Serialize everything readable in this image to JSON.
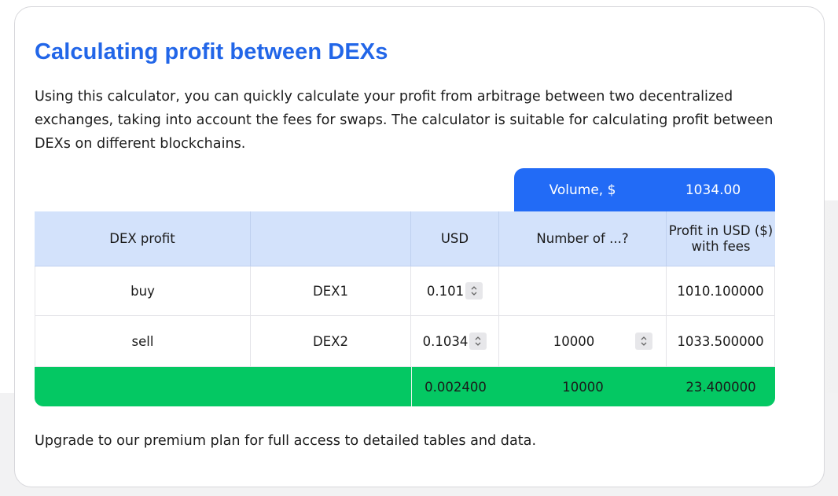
{
  "title": "Calculating profit between DEXs",
  "description": "Using this calculator, you can quickly calculate your profit from arbitrage between two decentralized exchanges, taking into account the fees for swaps. The calculator is suitable for calculating profit between DEXs on different blockchains.",
  "volume": {
    "label": "Volume, $",
    "value": "1034.00"
  },
  "table": {
    "headers": [
      "DEX profit",
      "",
      "USD",
      "Number of ...?",
      "Profit in USD ($) with fees"
    ],
    "rows": [
      {
        "side": "buy",
        "dex": "DEX1",
        "usd": "0.101",
        "qty": "",
        "profit": "1010.100000"
      },
      {
        "side": "sell",
        "dex": "DEX2",
        "usd": "0.1034",
        "qty": "10000",
        "profit": "1033.500000"
      }
    ],
    "totals": {
      "usd": "0.002400",
      "qty": "10000",
      "profit": "23.400000"
    }
  },
  "upgrade_note": "Upgrade to our premium plan for full access to detailed tables and data.",
  "colors": {
    "accent": "#226bf6",
    "title": "#2266e8",
    "header_bg": "#d3e2fb",
    "total_bg": "#04c863"
  }
}
